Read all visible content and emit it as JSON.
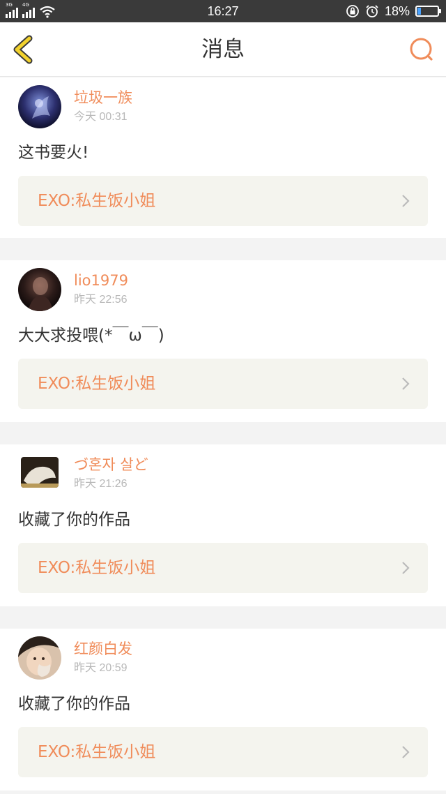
{
  "status_bar": {
    "time": "16:27",
    "battery_percent": "18%",
    "battery_level": 0.18,
    "network_1": "3G",
    "network_2": "4G",
    "icons": [
      "signal-icon",
      "signal-icon",
      "wifi-icon",
      "lock-rotation-icon",
      "alarm-icon",
      "battery-icon"
    ]
  },
  "header": {
    "title": "消息",
    "back_icon": "back-chevron-icon",
    "search_icon": "search-icon",
    "accent": "#f08c5a",
    "back_color": "#f2d22e"
  },
  "messages": [
    {
      "user": "垃圾一族",
      "time": "今天 00:31",
      "text": "这书要火!",
      "book": "EXO:私生饭小姐",
      "avatar": "avatar-image"
    },
    {
      "user": "lio1979",
      "time": "昨天 22:56",
      "text": "大大求投喂(*￣ω￣)",
      "book": "EXO:私生饭小姐",
      "avatar": "avatar-image"
    },
    {
      "user": "づ혼자 살ど",
      "time": "昨天 21:26",
      "text": "收藏了你的作品",
      "book": "EXO:私生饭小姐",
      "avatar": "avatar-image"
    },
    {
      "user": "红颜白发",
      "time": "昨天 20:59",
      "text": "收藏了你的作品",
      "book": "EXO:私生饭小姐",
      "avatar": "avatar-image"
    }
  ]
}
